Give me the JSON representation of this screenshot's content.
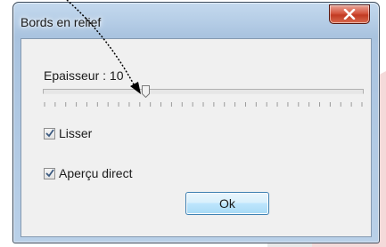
{
  "window": {
    "title": "Bords en relief"
  },
  "close": {
    "icon": "close-icon"
  },
  "thickness": {
    "label": "Epaisseur : 10",
    "value": 10,
    "min": 0,
    "max": 100,
    "position_fraction": 0.32
  },
  "options": [
    {
      "label": "Lisser",
      "checked": true
    },
    {
      "label": "Aperçu direct",
      "checked": true
    }
  ],
  "ok_button": {
    "label": "Ok"
  },
  "colors": {
    "close_red": "#c23a22",
    "title_bar": "#b5cde6",
    "client_bg": "#f0f0f0",
    "ok_border": "#3c7fb1"
  }
}
